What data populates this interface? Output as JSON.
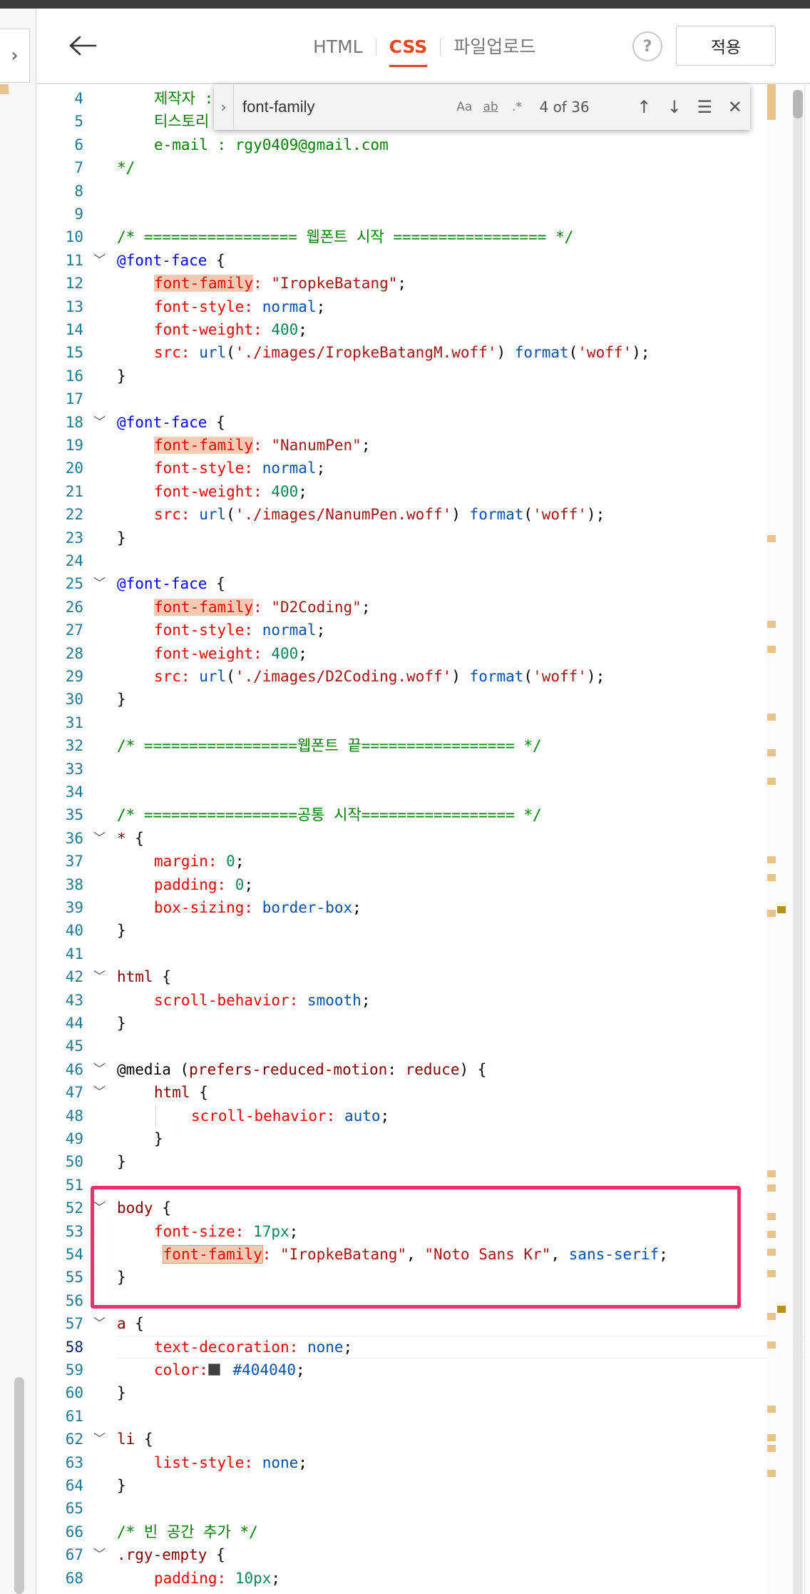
{
  "header": {
    "tabs": [
      {
        "label": "HTML",
        "active": false
      },
      {
        "label": "CSS",
        "active": true
      },
      {
        "label": "파일업로드",
        "active": false
      }
    ],
    "help_label": "?",
    "apply_label": "적용"
  },
  "find_widget": {
    "query": "font-family",
    "opt_case": "Aa",
    "opt_word": "ab",
    "opt_regex": ".*",
    "match_count": "4 of 36"
  },
  "colors": {
    "accent": "#e8461c",
    "highlight_frame": "#ee2f6a",
    "swatch": "#404040"
  },
  "editor": {
    "current_line": 58,
    "lines": [
      {
        "n": "4",
        "fold": false,
        "indent": 1,
        "tokens": [
          {
            "c": "t-comment",
            "t": "제작자 : "
          }
        ]
      },
      {
        "n": "5",
        "fold": false,
        "indent": 1,
        "tokens": [
          {
            "c": "t-comment",
            "t": "티스토리 : https://rgy0409.tistory.com"
          }
        ]
      },
      {
        "n": "6",
        "fold": false,
        "indent": 1,
        "tokens": [
          {
            "c": "t-comment",
            "t": "e-mail : rgy0409@gmail.com"
          }
        ]
      },
      {
        "n": "7",
        "fold": false,
        "indent": 0,
        "tokens": [
          {
            "c": "t-comment",
            "t": "*/"
          }
        ]
      },
      {
        "n": "8",
        "fold": false,
        "indent": 0,
        "tokens": []
      },
      {
        "n": "9",
        "fold": false,
        "indent": 0,
        "tokens": []
      },
      {
        "n": "10",
        "fold": false,
        "indent": 0,
        "tokens": [
          {
            "c": "t-comment",
            "t": "/* ================= 웹폰트 시작 ================= */"
          }
        ]
      },
      {
        "n": "11",
        "fold": true,
        "indent": 0,
        "tokens": [
          {
            "c": "t-at",
            "t": "@font-face"
          },
          {
            "c": "t-punct",
            "t": " {"
          }
        ]
      },
      {
        "n": "12",
        "fold": false,
        "indent": 1,
        "tokens": [
          {
            "c": "t-prop hl",
            "t": "font-family"
          },
          {
            "c": "t-prop",
            "t": ":"
          },
          {
            "c": "t-str",
            "t": " \"IropkeBatang\""
          },
          {
            "c": "t-punct",
            "t": ";"
          }
        ]
      },
      {
        "n": "13",
        "fold": false,
        "indent": 1,
        "tokens": [
          {
            "c": "t-prop",
            "t": "font-style:"
          },
          {
            "c": "t-val",
            "t": " normal"
          },
          {
            "c": "t-punct",
            "t": ";"
          }
        ]
      },
      {
        "n": "14",
        "fold": false,
        "indent": 1,
        "tokens": [
          {
            "c": "t-prop",
            "t": "font-weight:"
          },
          {
            "c": "t-num",
            "t": " 400"
          },
          {
            "c": "t-punct",
            "t": ";"
          }
        ]
      },
      {
        "n": "15",
        "fold": false,
        "indent": 1,
        "tokens": [
          {
            "c": "t-prop",
            "t": "src:"
          },
          {
            "c": "t-val",
            "t": " url"
          },
          {
            "c": "t-punct",
            "t": "("
          },
          {
            "c": "t-str",
            "t": "'./images/IropkeBatangM.woff'"
          },
          {
            "c": "t-punct",
            "t": ") "
          },
          {
            "c": "t-val",
            "t": "format"
          },
          {
            "c": "t-punct",
            "t": "("
          },
          {
            "c": "t-str",
            "t": "'woff'"
          },
          {
            "c": "t-punct",
            "t": ");"
          }
        ]
      },
      {
        "n": "16",
        "fold": false,
        "indent": 0,
        "tokens": [
          {
            "c": "t-punct",
            "t": "}"
          }
        ]
      },
      {
        "n": "17",
        "fold": false,
        "indent": 0,
        "tokens": []
      },
      {
        "n": "18",
        "fold": true,
        "indent": 0,
        "tokens": [
          {
            "c": "t-at",
            "t": "@font-face"
          },
          {
            "c": "t-punct",
            "t": " {"
          }
        ]
      },
      {
        "n": "19",
        "fold": false,
        "indent": 1,
        "tokens": [
          {
            "c": "t-prop hl",
            "t": "font-family"
          },
          {
            "c": "t-prop",
            "t": ":"
          },
          {
            "c": "t-str",
            "t": " \"NanumPen\""
          },
          {
            "c": "t-punct",
            "t": ";"
          }
        ]
      },
      {
        "n": "20",
        "fold": false,
        "indent": 1,
        "tokens": [
          {
            "c": "t-prop",
            "t": "font-style:"
          },
          {
            "c": "t-val",
            "t": " normal"
          },
          {
            "c": "t-punct",
            "t": ";"
          }
        ]
      },
      {
        "n": "21",
        "fold": false,
        "indent": 1,
        "tokens": [
          {
            "c": "t-prop",
            "t": "font-weight:"
          },
          {
            "c": "t-num",
            "t": " 400"
          },
          {
            "c": "t-punct",
            "t": ";"
          }
        ]
      },
      {
        "n": "22",
        "fold": false,
        "indent": 1,
        "tokens": [
          {
            "c": "t-prop",
            "t": "src:"
          },
          {
            "c": "t-val",
            "t": " url"
          },
          {
            "c": "t-punct",
            "t": "("
          },
          {
            "c": "t-str",
            "t": "'./images/NanumPen.woff'"
          },
          {
            "c": "t-punct",
            "t": ") "
          },
          {
            "c": "t-val",
            "t": "format"
          },
          {
            "c": "t-punct",
            "t": "("
          },
          {
            "c": "t-str",
            "t": "'woff'"
          },
          {
            "c": "t-punct",
            "t": ");"
          }
        ]
      },
      {
        "n": "23",
        "fold": false,
        "indent": 0,
        "tokens": [
          {
            "c": "t-punct",
            "t": "}"
          }
        ]
      },
      {
        "n": "24",
        "fold": false,
        "indent": 0,
        "tokens": []
      },
      {
        "n": "25",
        "fold": true,
        "indent": 0,
        "tokens": [
          {
            "c": "t-at",
            "t": "@font-face"
          },
          {
            "c": "t-punct",
            "t": " {"
          }
        ]
      },
      {
        "n": "26",
        "fold": false,
        "indent": 1,
        "tokens": [
          {
            "c": "t-prop hl",
            "t": "font-family"
          },
          {
            "c": "t-prop",
            "t": ":"
          },
          {
            "c": "t-str",
            "t": " \"D2Coding\""
          },
          {
            "c": "t-punct",
            "t": ";"
          }
        ]
      },
      {
        "n": "27",
        "fold": false,
        "indent": 1,
        "tokens": [
          {
            "c": "t-prop",
            "t": "font-style:"
          },
          {
            "c": "t-val",
            "t": " normal"
          },
          {
            "c": "t-punct",
            "t": ";"
          }
        ]
      },
      {
        "n": "28",
        "fold": false,
        "indent": 1,
        "tokens": [
          {
            "c": "t-prop",
            "t": "font-weight:"
          },
          {
            "c": "t-num",
            "t": " 400"
          },
          {
            "c": "t-punct",
            "t": ";"
          }
        ]
      },
      {
        "n": "29",
        "fold": false,
        "indent": 1,
        "tokens": [
          {
            "c": "t-prop",
            "t": "src:"
          },
          {
            "c": "t-val",
            "t": " url"
          },
          {
            "c": "t-punct",
            "t": "("
          },
          {
            "c": "t-str",
            "t": "'./images/D2Coding.woff'"
          },
          {
            "c": "t-punct",
            "t": ") "
          },
          {
            "c": "t-val",
            "t": "format"
          },
          {
            "c": "t-punct",
            "t": "("
          },
          {
            "c": "t-str",
            "t": "'woff'"
          },
          {
            "c": "t-punct",
            "t": ");"
          }
        ]
      },
      {
        "n": "30",
        "fold": false,
        "indent": 0,
        "tokens": [
          {
            "c": "t-punct",
            "t": "}"
          }
        ]
      },
      {
        "n": "31",
        "fold": false,
        "indent": 0,
        "tokens": []
      },
      {
        "n": "32",
        "fold": false,
        "indent": 0,
        "tokens": [
          {
            "c": "t-comment",
            "t": "/* =================웹폰트 끝================= */"
          }
        ]
      },
      {
        "n": "33",
        "fold": false,
        "indent": 0,
        "tokens": []
      },
      {
        "n": "34",
        "fold": false,
        "indent": 0,
        "tokens": []
      },
      {
        "n": "35",
        "fold": false,
        "indent": 0,
        "tokens": [
          {
            "c": "t-comment",
            "t": "/* =================공통 시작================= */"
          }
        ]
      },
      {
        "n": "36",
        "fold": true,
        "indent": 0,
        "tokens": [
          {
            "c": "t-sel",
            "t": "*"
          },
          {
            "c": "t-punct",
            "t": " {"
          }
        ]
      },
      {
        "n": "37",
        "fold": false,
        "indent": 1,
        "tokens": [
          {
            "c": "t-prop",
            "t": "margin:"
          },
          {
            "c": "t-num",
            "t": " 0"
          },
          {
            "c": "t-punct",
            "t": ";"
          }
        ]
      },
      {
        "n": "38",
        "fold": false,
        "indent": 1,
        "tokens": [
          {
            "c": "t-prop",
            "t": "padding:"
          },
          {
            "c": "t-num",
            "t": " 0"
          },
          {
            "c": "t-punct",
            "t": ";"
          }
        ]
      },
      {
        "n": "39",
        "fold": false,
        "indent": 1,
        "tokens": [
          {
            "c": "t-prop",
            "t": "box-sizing:"
          },
          {
            "c": "t-val",
            "t": " border-box"
          },
          {
            "c": "t-punct",
            "t": ";"
          }
        ]
      },
      {
        "n": "40",
        "fold": false,
        "indent": 0,
        "tokens": [
          {
            "c": "t-punct",
            "t": "}"
          }
        ]
      },
      {
        "n": "41",
        "fold": false,
        "indent": 0,
        "tokens": []
      },
      {
        "n": "42",
        "fold": true,
        "indent": 0,
        "tokens": [
          {
            "c": "t-sel",
            "t": "html"
          },
          {
            "c": "t-punct",
            "t": " {"
          }
        ]
      },
      {
        "n": "43",
        "fold": false,
        "indent": 1,
        "tokens": [
          {
            "c": "t-prop",
            "t": "scroll-behavior:"
          },
          {
            "c": "t-val",
            "t": " smooth"
          },
          {
            "c": "t-punct",
            "t": ";"
          }
        ]
      },
      {
        "n": "44",
        "fold": false,
        "indent": 0,
        "tokens": [
          {
            "c": "t-punct",
            "t": "}"
          }
        ]
      },
      {
        "n": "45",
        "fold": false,
        "indent": 0,
        "tokens": []
      },
      {
        "n": "46",
        "fold": true,
        "indent": 0,
        "tokens": [
          {
            "c": "t-media",
            "t": "@media ("
          },
          {
            "c": "t-sel",
            "t": "prefers-reduced-motion"
          },
          {
            "c": "t-media",
            "t": ": "
          },
          {
            "c": "t-sel",
            "t": "reduce"
          },
          {
            "c": "t-media",
            "t": ") {"
          }
        ]
      },
      {
        "n": "47",
        "fold": true,
        "indent": 1,
        "tokens": [
          {
            "c": "t-sel",
            "t": "html"
          },
          {
            "c": "t-punct",
            "t": " {"
          }
        ]
      },
      {
        "n": "48",
        "fold": false,
        "indent": 2,
        "tokens": [
          {
            "c": "t-prop",
            "t": "scroll-behavior:"
          },
          {
            "c": "t-val",
            "t": " auto"
          },
          {
            "c": "t-punct",
            "t": ";"
          }
        ]
      },
      {
        "n": "49",
        "fold": false,
        "indent": 1,
        "tokens": [
          {
            "c": "t-punct",
            "t": "}"
          }
        ]
      },
      {
        "n": "50",
        "fold": false,
        "indent": 0,
        "tokens": [
          {
            "c": "t-punct",
            "t": "}"
          }
        ]
      },
      {
        "n": "51",
        "fold": false,
        "indent": 0,
        "tokens": []
      },
      {
        "n": "52",
        "fold": true,
        "indent": 0,
        "tokens": [
          {
            "c": "t-sel",
            "t": "body"
          },
          {
            "c": "t-punct",
            "t": " {"
          }
        ]
      },
      {
        "n": "53",
        "fold": false,
        "indent": 1,
        "tokens": [
          {
            "c": "t-prop",
            "t": "font-size:"
          },
          {
            "c": "t-num",
            "t": " 17px"
          },
          {
            "c": "t-punct",
            "t": ";"
          }
        ]
      },
      {
        "n": "54",
        "fold": false,
        "indent": 1,
        "tokens": [
          {
            "c": "t-punct",
            "t": " "
          },
          {
            "c": "t-prop hl-cur",
            "t": "font-family"
          },
          {
            "c": "t-prop",
            "t": ":"
          },
          {
            "c": "t-str",
            "t": " \"IropkeBatang\""
          },
          {
            "c": "t-punct",
            "t": ", "
          },
          {
            "c": "t-str",
            "t": "\"Noto Sans Kr\""
          },
          {
            "c": "t-punct",
            "t": ", "
          },
          {
            "c": "t-val",
            "t": "sans-serif"
          },
          {
            "c": "t-punct",
            "t": ";"
          }
        ]
      },
      {
        "n": "55",
        "fold": false,
        "indent": 0,
        "tokens": [
          {
            "c": "t-punct",
            "t": "}"
          }
        ]
      },
      {
        "n": "56",
        "fold": false,
        "indent": 0,
        "tokens": []
      },
      {
        "n": "57",
        "fold": true,
        "indent": 0,
        "tokens": [
          {
            "c": "t-sel",
            "t": "a"
          },
          {
            "c": "t-punct",
            "t": " {"
          }
        ]
      },
      {
        "n": "58",
        "fold": false,
        "indent": 1,
        "tokens": [
          {
            "c": "t-prop",
            "t": "text-decoration:"
          },
          {
            "c": "t-val",
            "t": " none"
          },
          {
            "c": "t-punct",
            "t": ";"
          }
        ]
      },
      {
        "n": "59",
        "fold": false,
        "indent": 1,
        "swatch": true,
        "tokens": [
          {
            "c": "t-prop",
            "t": "color:"
          },
          {
            "c": "t-punct",
            "t": " "
          },
          {
            "c": "t-val",
            "t": "#404040"
          },
          {
            "c": "t-punct",
            "t": ";"
          }
        ]
      },
      {
        "n": "60",
        "fold": false,
        "indent": 0,
        "tokens": [
          {
            "c": "t-punct",
            "t": "}"
          }
        ]
      },
      {
        "n": "61",
        "fold": false,
        "indent": 0,
        "tokens": []
      },
      {
        "n": "62",
        "fold": true,
        "indent": 0,
        "tokens": [
          {
            "c": "t-sel",
            "t": "li"
          },
          {
            "c": "t-punct",
            "t": " {"
          }
        ]
      },
      {
        "n": "63",
        "fold": false,
        "indent": 1,
        "tokens": [
          {
            "c": "t-prop",
            "t": "list-style:"
          },
          {
            "c": "t-val",
            "t": " none"
          },
          {
            "c": "t-punct",
            "t": ";"
          }
        ]
      },
      {
        "n": "64",
        "fold": false,
        "indent": 0,
        "tokens": [
          {
            "c": "t-punct",
            "t": "}"
          }
        ]
      },
      {
        "n": "65",
        "fold": false,
        "indent": 0,
        "tokens": []
      },
      {
        "n": "66",
        "fold": false,
        "indent": 0,
        "tokens": [
          {
            "c": "t-comment",
            "t": "/* 빈 공간 추가 */"
          }
        ]
      },
      {
        "n": "67",
        "fold": true,
        "indent": 0,
        "tokens": [
          {
            "c": "t-sel",
            "t": ".rgy-empty"
          },
          {
            "c": "t-punct",
            "t": " {"
          }
        ]
      },
      {
        "n": "68",
        "fold": false,
        "indent": 1,
        "tokens": [
          {
            "c": "t-prop",
            "t": "padding:"
          },
          {
            "c": "t-num",
            "t": " 10px"
          },
          {
            "c": "t-punct",
            "t": ";"
          }
        ]
      }
    ]
  }
}
